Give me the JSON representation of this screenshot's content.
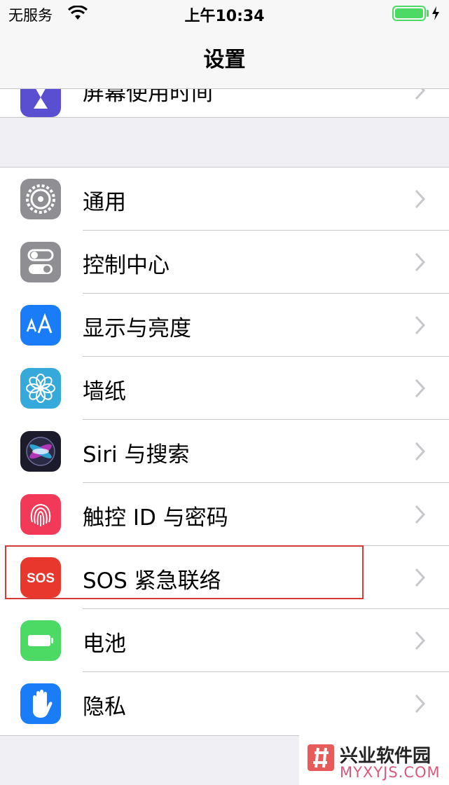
{
  "status_bar": {
    "carrier": "无服务",
    "time": "上午10:34"
  },
  "nav": {
    "title": "设置"
  },
  "top_row": {
    "label": "屏幕使用时间"
  },
  "settings_items": [
    {
      "label": "通用",
      "icon": "gear-icon",
      "color": "#8e8e93"
    },
    {
      "label": "控制中心",
      "icon": "toggles-icon",
      "color": "#8e8e93"
    },
    {
      "label": "显示与亮度",
      "icon": "text-size-icon",
      "color": "#1a7cf7"
    },
    {
      "label": "墙纸",
      "icon": "flower-icon",
      "color": "#35a9d9"
    },
    {
      "label": "Siri 与搜索",
      "icon": "siri-icon",
      "color": "#1b1b2b"
    },
    {
      "label": "触控 ID 与密码",
      "icon": "fingerprint-icon",
      "color": "#f23a58"
    },
    {
      "label": "SOS 紧急联络",
      "icon": "sos-icon",
      "color": "#e8372c",
      "icon_text": "SOS",
      "highlighted": true
    },
    {
      "label": "电池",
      "icon": "battery-icon",
      "color": "#4cd964"
    },
    {
      "label": "隐私",
      "icon": "hand-icon",
      "color": "#1a7cf7"
    }
  ],
  "watermark": {
    "name": "兴业软件园",
    "domain": "MYXYJS.COM"
  },
  "colors": {
    "highlight_border": "#d83a3a",
    "separator": "#c8c7cc",
    "background": "#efeff4"
  }
}
